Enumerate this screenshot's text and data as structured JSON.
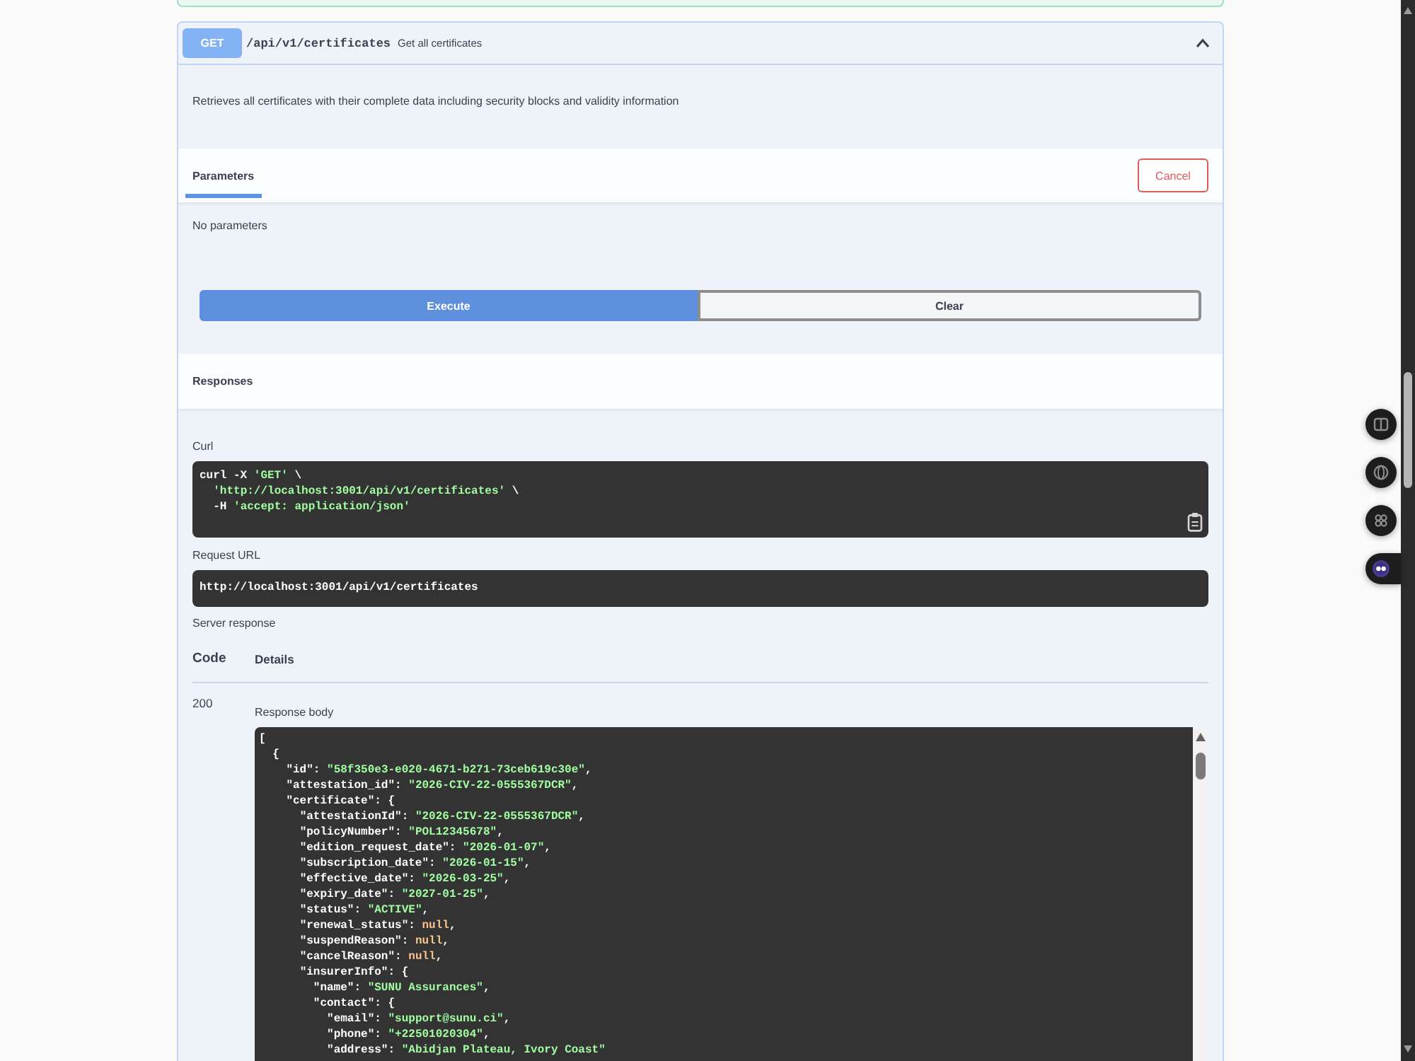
{
  "operation": {
    "method": "GET",
    "path": "/api/v1/certificates",
    "summary": "Get all certificates",
    "expanded": true,
    "description": "Retrieves all certificates with their complete data including security blocks and validity information"
  },
  "parameters": {
    "tabs": [
      {
        "label": "Parameters",
        "selected": true
      }
    ],
    "cancel_button": "Cancel",
    "message": "No parameters"
  },
  "actions": [
    {
      "label": "Execute",
      "kind": "primary"
    },
    {
      "label": "Clear",
      "kind": "secondary"
    }
  ],
  "responses": {
    "title": "Responses",
    "curl": {
      "label": "Curl",
      "lines": [
        "curl -X 'GET' \\",
        "  'http://localhost:3001/api/v1/certificates' \\",
        "  -H 'accept: application/json'"
      ]
    },
    "request_url": {
      "label": "Request URL",
      "value": "http://localhost:3001/api/v1/certificates"
    },
    "server_response": {
      "label": "Server response",
      "columns": [
        "Code",
        "Details"
      ],
      "rows": [
        {
          "code": "200",
          "body_label": "Response body",
          "body_lines": [
            "[",
            "  {",
            "    \"id\": \"58f350e3-e020-4671-b271-73ceb619c30e\",",
            "    \"attestation_id\": \"2026-CIV-22-0555367DCR\",",
            "    \"certificate\": {",
            "      \"attestationId\": \"2026-CIV-22-0555367DCR\",",
            "      \"policyNumber\": \"POL12345678\",",
            "      \"edition_request_date\": \"2026-01-07\",",
            "      \"subscription_date\": \"2026-01-15\",",
            "      \"effective_date\": \"2026-03-25\",",
            "      \"expiry_date\": \"2027-01-25\",",
            "      \"status\": \"ACTIVE\",",
            "      \"renewal_status\": null,",
            "      \"suspendReason\": null,",
            "      \"cancelReason\": null,",
            "      \"insurerInfo\": {",
            "        \"name\": \"SUNU Assurances\",",
            "        \"contact\": {",
            "          \"email\": \"support@sunu.ci\",",
            "          \"phone\": \"+22501020304\",",
            "          \"address\": \"Abidjan Plateau, Ivory Coast\""
          ]
        }
      ]
    }
  }
}
